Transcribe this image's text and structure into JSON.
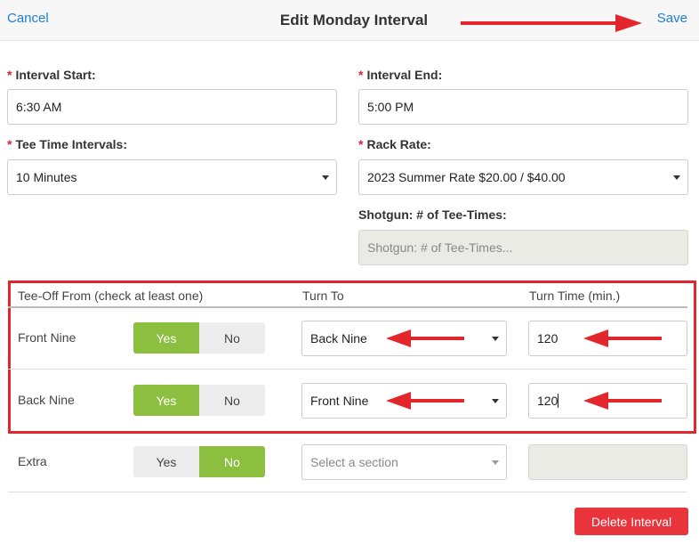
{
  "header": {
    "cancel_label": "Cancel",
    "title": "Edit Monday Interval",
    "save_label": "Save"
  },
  "form": {
    "interval_start": {
      "label": "Interval Start:",
      "value": "6:30 AM"
    },
    "interval_end": {
      "label": "Interval End:",
      "value": "5:00 PM"
    },
    "tee_time_intervals": {
      "label": "Tee Time Intervals:",
      "value": "10 Minutes"
    },
    "rack_rate": {
      "label": "Rack Rate:",
      "value": "2023 Summer Rate $20.00 / $40.00"
    },
    "shotgun": {
      "label": "Shotgun: # of Tee-Times:",
      "placeholder": "Shotgun: # of Tee-Times..."
    },
    "required_mark": "*"
  },
  "table": {
    "headers": [
      "Tee-Off From (check at least one)",
      "Turn To",
      "Turn Time (min.)"
    ],
    "rows": [
      {
        "label": "Front Nine",
        "yes": "Yes",
        "no": "No",
        "selected": "yes",
        "turn_to": "Back Nine",
        "turn_time": "120"
      },
      {
        "label": "Back Nine",
        "yes": "Yes",
        "no": "No",
        "selected": "yes",
        "turn_to": "Front Nine",
        "turn_time": "120"
      },
      {
        "label": "Extra",
        "yes": "Yes",
        "no": "No",
        "selected": "no",
        "turn_to": "Select a section",
        "turn_time": ""
      }
    ]
  },
  "delete_label": "Delete Interval",
  "colors": {
    "link": "#1a7fd6",
    "toggle_on": "#8cbf3f",
    "annotation_red": "#e3262b",
    "delete_button": "#e8343a"
  }
}
